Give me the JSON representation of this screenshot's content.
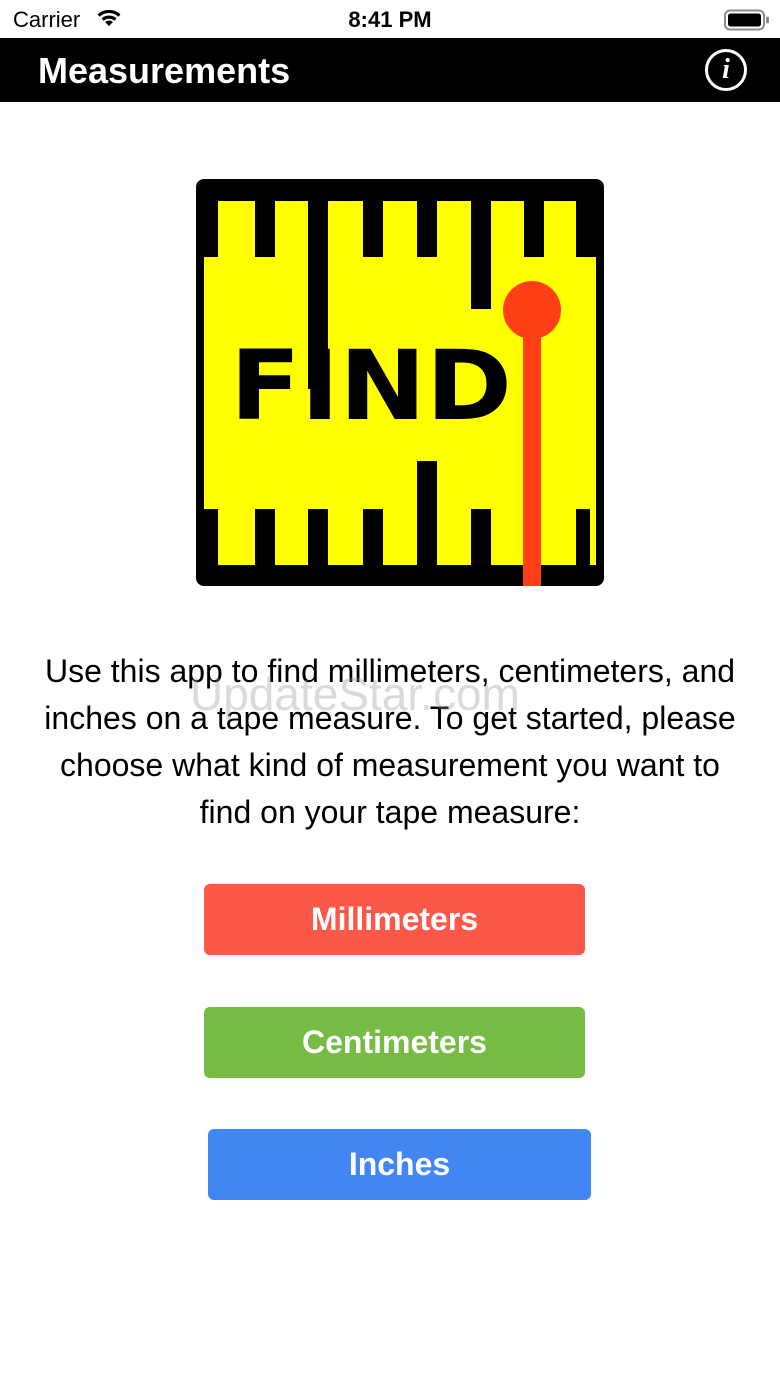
{
  "status_bar": {
    "carrier": "Carrier",
    "time": "8:41 PM",
    "icons": [
      "wifi-icon",
      "battery-icon"
    ]
  },
  "nav": {
    "title": "Measurements",
    "info_icon": "i",
    "background": "#000000",
    "title_color": "#ffffff"
  },
  "logo": {
    "text": "FIND",
    "background": "#ffff00",
    "marker_color": "#ff4016",
    "tick_color": "#000000"
  },
  "intro": {
    "text": "Use this app to find millimeters, centimeters, and inches on a tape measure. To get started, please choose what kind of measurement you want to find on your tape measure:"
  },
  "watermark": "UpdateStar.com",
  "buttons": {
    "millimeters": {
      "label": "Millimeters",
      "color": "#fc5849"
    },
    "centimeters": {
      "label": "Centimeters",
      "color": "#76bb43"
    },
    "inches": {
      "label": "Inches",
      "color": "#4286f4"
    }
  }
}
